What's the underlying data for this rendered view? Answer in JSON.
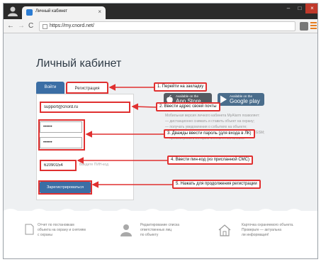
{
  "browser": {
    "tab_title": "Личный кабинет",
    "url": "https://my.cnord.net/"
  },
  "page": {
    "heading": "Личный кабинет",
    "tabs": [
      {
        "label": "Войти"
      },
      {
        "label": "Регистрация"
      }
    ],
    "form": {
      "email_value": "support@cnord.ru",
      "password_value": "••••••",
      "password_confirm_value": "••••••",
      "pin_value": "62090154",
      "pin_hint": "Введите ПИН-код",
      "submit_label": "Зарегистрироваться"
    },
    "stores": {
      "apple_small": "Available on the",
      "apple_big": "App Store",
      "google_small": "Available on the",
      "google_big": "Google play"
    },
    "description_lines": [
      "Мобильная версия личного кабинета MyAlarm позволяет:",
      "— дистанционно снимать и ставить объект на охрану;",
      "— получать уведомления о событиях на объекте;",
      "— смотреть статус охраны объекта и уровень сигнала GSM;",
      "— просматривать историю снятий и постановок."
    ],
    "callouts": [
      "1. Перейти на закладку",
      "2. Ввести адрес своей почты",
      "3. Дважды ввести пароль (для входа в ЛК)",
      "4. Ввести пин-код (из присланной СМС)",
      "5. Нажать для продолжения регистрации"
    ],
    "features": [
      {
        "lines": [
          "Отчет по постановкам",
          "объекта на охрану и снятиям",
          "с охраны"
        ],
        "icon": "document-icon"
      },
      {
        "lines": [
          "Редактирование списка",
          "ответственных лиц",
          "по объекту"
        ],
        "icon": "person-icon"
      },
      {
        "lines": [
          "Карточка охраняемого объекта.",
          "Проверьте — актуальна",
          "ли информация!"
        ],
        "icon": "house-icon"
      }
    ]
  },
  "colors": {
    "accent_blue": "#3b6ea5",
    "annotation_red": "#e03030"
  }
}
